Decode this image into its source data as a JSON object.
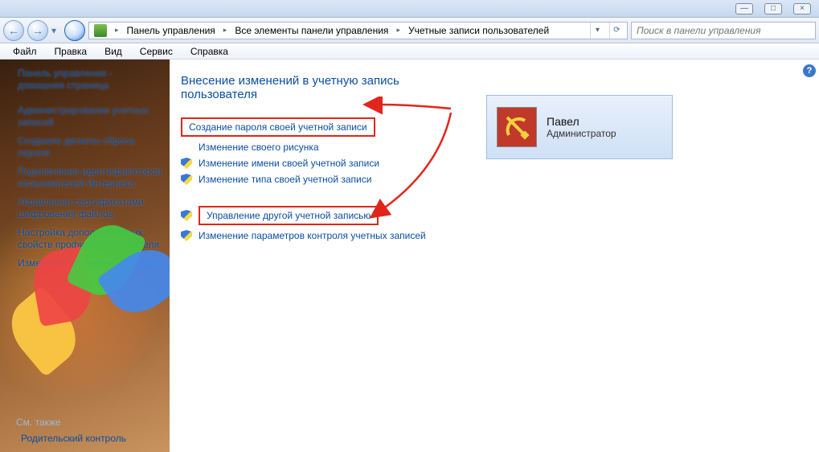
{
  "titlebar": {
    "minimize": "—",
    "maximize": "□",
    "close": "×"
  },
  "nav": {
    "back": "←",
    "forward": "→",
    "up": "↑",
    "crumbs": [
      "Панель управления",
      "Все элементы панели управления",
      "Учетные записи пользователей"
    ],
    "sep": "▸",
    "dropdown": "▾",
    "refresh": "⟳"
  },
  "search": {
    "placeholder": "Поиск в панели управления"
  },
  "menu": {
    "file": "Файл",
    "edit": "Правка",
    "view": "Вид",
    "service": "Сервис",
    "help": "Справка"
  },
  "sidebar": {
    "items": [
      "Панель управления -\nдомашняя страница",
      "Администрирование учетных записей",
      "Создание дискеты сброса пароля",
      "Подключение идентификаторов пользователей Интернета",
      "Управление сертификатами шифрования файлов",
      "Настройка дополнительных свойств профиля пользователя",
      "Изменение переменных среды"
    ],
    "footer_header": "См. также",
    "footer_link": "Родительский контроль"
  },
  "content": {
    "heading": "Внесение изменений в учетную запись пользователя",
    "group1": [
      "Создание пароля своей учетной записи",
      "Изменение своего рисунка",
      "Изменение имени своей учетной записи",
      "Изменение типа своей учетной записи"
    ],
    "group2": [
      "Управление другой учетной записью",
      "Изменение параметров контроля учетных записей"
    ]
  },
  "user": {
    "name": "Павел",
    "role": "Администратор"
  },
  "help": "?"
}
